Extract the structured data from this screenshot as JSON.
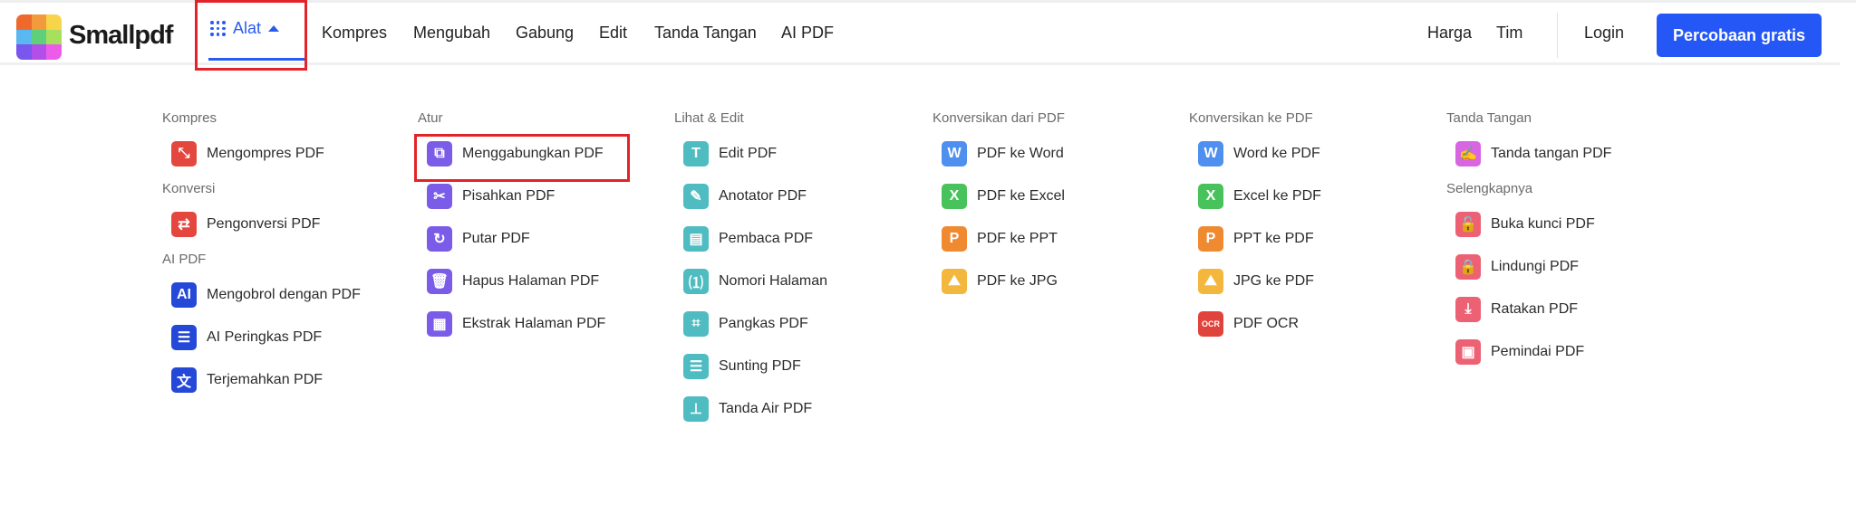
{
  "header": {
    "brand": "Smallpdf",
    "alat_label": "Alat",
    "nav": [
      "Kompres",
      "Mengubah",
      "Gabung",
      "Edit",
      "Tanda Tangan",
      "AI PDF"
    ],
    "harga": "Harga",
    "tim": "Tim",
    "login": "Login",
    "cta": "Percobaan gratis",
    "accent": "#2457f5"
  },
  "columns": [
    {
      "sections": [
        {
          "title": "Kompres",
          "items": [
            {
              "label": "Mengompres PDF",
              "icon": "compress-icon",
              "glyph": "⤡",
              "color": "#e3473e"
            }
          ]
        },
        {
          "title": "Konversi",
          "items": [
            {
              "label": "Pengonversi PDF",
              "icon": "convert-icon",
              "glyph": "⇄",
              "color": "#e3473e"
            }
          ]
        },
        {
          "title": "AI PDF",
          "items": [
            {
              "label": "Mengobrol dengan PDF",
              "icon": "ai-chat-icon",
              "glyph": "AI",
              "color": "#2448d8"
            },
            {
              "label": "AI Peringkas PDF",
              "icon": "list-icon",
              "glyph": "☰",
              "color": "#2448d8"
            },
            {
              "label": "Terjemahkan PDF",
              "icon": "translate-icon",
              "glyph": "文",
              "color": "#2448d8"
            }
          ]
        }
      ]
    },
    {
      "sections": [
        {
          "title": "Atur",
          "items": [
            {
              "label": "Menggabungkan PDF",
              "icon": "merge-icon",
              "glyph": "⧉",
              "color": "#7a5ce8"
            },
            {
              "label": "Pisahkan PDF",
              "icon": "scissors-icon",
              "glyph": "✂",
              "color": "#7a5ce8"
            },
            {
              "label": "Putar PDF",
              "icon": "rotate-icon",
              "glyph": "↻",
              "color": "#7a5ce8"
            },
            {
              "label": "Hapus Halaman PDF",
              "icon": "trash-icon",
              "glyph": "🗑",
              "color": "#7a5ce8"
            },
            {
              "label": "Ekstrak Halaman PDF",
              "icon": "extract-icon",
              "glyph": "▦",
              "color": "#7a5ce8"
            }
          ]
        }
      ]
    },
    {
      "sections": [
        {
          "title": "Lihat & Edit",
          "items": [
            {
              "label": "Edit PDF",
              "icon": "text-icon",
              "glyph": "T",
              "color": "#4fbcc2"
            },
            {
              "label": "Anotator PDF",
              "icon": "pencil-icon",
              "glyph": "✎",
              "color": "#4fbcc2"
            },
            {
              "label": "Pembaca PDF",
              "icon": "document-icon",
              "glyph": "▤",
              "color": "#4fbcc2"
            },
            {
              "label": "Nomori Halaman",
              "icon": "page-number-icon",
              "glyph": "⑴",
              "color": "#4fbcc2"
            },
            {
              "label": "Pangkas PDF",
              "icon": "crop-icon",
              "glyph": "⌗",
              "color": "#4fbcc2"
            },
            {
              "label": "Sunting PDF",
              "icon": "redact-icon",
              "glyph": "☰",
              "color": "#4fbcc2"
            },
            {
              "label": "Tanda Air PDF",
              "icon": "stamp-icon",
              "glyph": "⊥",
              "color": "#4fbcc2"
            }
          ]
        }
      ]
    },
    {
      "sections": [
        {
          "title": "Konversikan dari PDF",
          "items": [
            {
              "label": "PDF ke Word",
              "icon": "word-icon",
              "glyph": "W",
              "color": "#4e8ff0"
            },
            {
              "label": "PDF ke Excel",
              "icon": "excel-icon",
              "glyph": "X",
              "color": "#48c25a"
            },
            {
              "label": "PDF ke PPT",
              "icon": "ppt-icon",
              "glyph": "P",
              "color": "#f08a30"
            },
            {
              "label": "PDF ke JPG",
              "icon": "image-icon",
              "glyph": "⛰",
              "color": "#f4b73e"
            }
          ]
        }
      ]
    },
    {
      "sections": [
        {
          "title": "Konversikan ke PDF",
          "items": [
            {
              "label": "Word ke PDF",
              "icon": "word-icon",
              "glyph": "W",
              "color": "#4e8ff0"
            },
            {
              "label": "Excel ke PDF",
              "icon": "excel-icon",
              "glyph": "X",
              "color": "#48c25a"
            },
            {
              "label": "PPT ke PDF",
              "icon": "ppt-icon",
              "glyph": "P",
              "color": "#f08a30"
            },
            {
              "label": "JPG ke PDF",
              "icon": "image-icon",
              "glyph": "⛰",
              "color": "#f4b73e"
            },
            {
              "label": "PDF OCR",
              "icon": "ocr-icon",
              "glyph": "OCR",
              "color": "#e0433b"
            }
          ]
        }
      ]
    },
    {
      "sections": [
        {
          "title": "Tanda Tangan",
          "items": [
            {
              "label": "Tanda tangan PDF",
              "icon": "signature-icon",
              "glyph": "✍",
              "color": "#d866e2"
            }
          ]
        },
        {
          "title": "Selengkapnya",
          "items": [
            {
              "label": "Buka kunci PDF",
              "icon": "unlock-icon",
              "glyph": "🔓",
              "color": "#ec6274"
            },
            {
              "label": "Lindungi PDF",
              "icon": "lock-icon",
              "glyph": "🔒",
              "color": "#ec6274"
            },
            {
              "label": "Ratakan PDF",
              "icon": "flatten-icon",
              "glyph": "⤓",
              "color": "#ec6274"
            },
            {
              "label": "Pemindai PDF",
              "icon": "scan-icon",
              "glyph": "▣",
              "color": "#ec6274"
            }
          ]
        }
      ]
    }
  ]
}
